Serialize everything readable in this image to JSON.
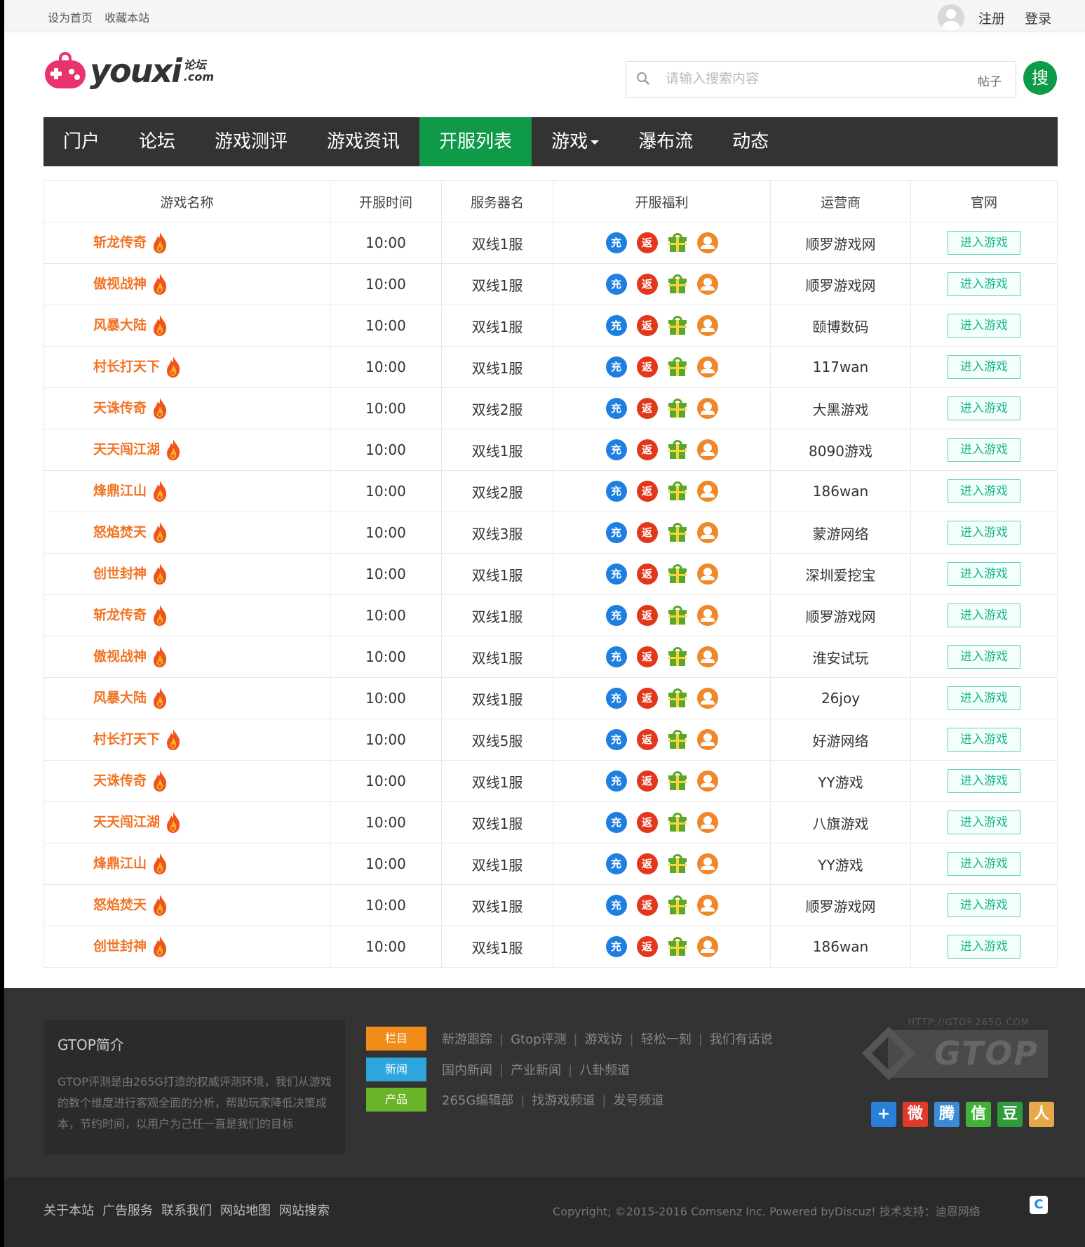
{
  "topbar": {
    "set_home": "设为首页",
    "bookmark": "收藏本站",
    "register": "注册",
    "login": "登录"
  },
  "logo": {
    "word": "youxi",
    "sub1": "论坛",
    "sub2": ".com"
  },
  "search": {
    "placeholder": "请输入搜索内容",
    "type": "帖子",
    "button": "搜"
  },
  "nav": [
    "门户",
    "论坛",
    "游戏测评",
    "游戏资讯",
    "开服列表",
    "游戏",
    "瀑布流",
    "动态"
  ],
  "table": {
    "headers": [
      "游戏名称",
      "开服时间",
      "服务器名",
      "开服福利",
      "运营商",
      "官网"
    ],
    "perk_icons": {
      "recharge": "充",
      "rebate": "返",
      "gift": "gift-icon",
      "service": "service-icon"
    },
    "enter_label": "进入游戏",
    "rows": [
      {
        "name": "斩龙传奇",
        "time": "10:00",
        "server": "双线1服",
        "op": "顺罗游戏网"
      },
      {
        "name": "傲视战神",
        "time": "10:00",
        "server": "双线1服",
        "op": "顺罗游戏网"
      },
      {
        "name": "风暴大陆",
        "time": "10:00",
        "server": "双线1服",
        "op": "颐博数码"
      },
      {
        "name": "村长打天下",
        "time": "10:00",
        "server": "双线1服",
        "op": "117wan"
      },
      {
        "name": "天诛传奇",
        "time": "10:00",
        "server": "双线2服",
        "op": "大黑游戏"
      },
      {
        "name": "天天闯江湖",
        "time": "10:00",
        "server": "双线1服",
        "op": "8090游戏"
      },
      {
        "name": "烽鼎江山",
        "time": "10:00",
        "server": "双线2服",
        "op": "186wan"
      },
      {
        "name": "怒焰焚天",
        "time": "10:00",
        "server": "双线3服",
        "op": "蒙游网络"
      },
      {
        "name": "创世封神",
        "time": "10:00",
        "server": "双线1服",
        "op": "深圳爱挖宝"
      },
      {
        "name": "斩龙传奇",
        "time": "10:00",
        "server": "双线1服",
        "op": "顺罗游戏网"
      },
      {
        "name": "傲视战神",
        "time": "10:00",
        "server": "双线1服",
        "op": "淮安试玩"
      },
      {
        "name": "风暴大陆",
        "time": "10:00",
        "server": "双线1服",
        "op": "26joy"
      },
      {
        "name": "村长打天下",
        "time": "10:00",
        "server": "双线5服",
        "op": "好游网络"
      },
      {
        "name": "天诛传奇",
        "time": "10:00",
        "server": "双线1服",
        "op": "YY游戏"
      },
      {
        "name": "天天闯江湖",
        "time": "10:00",
        "server": "双线1服",
        "op": "八旗游戏"
      },
      {
        "name": "烽鼎江山",
        "time": "10:00",
        "server": "双线1服",
        "op": "YY游戏"
      },
      {
        "name": "怒焰焚天",
        "time": "10:00",
        "server": "双线1服",
        "op": "顺罗游戏网"
      },
      {
        "name": "创世封神",
        "time": "10:00",
        "server": "双线1服",
        "op": "186wan"
      }
    ]
  },
  "footer": {
    "intro_title": "GTOP简介",
    "intro_text": "GTOP评测是由265G打造的权威评测环境，我们从游戏的数个维度进行客观全面的分析，帮助玩家降低决策成本，节约时间，以用户为己任一直是我们的目标",
    "categories": [
      {
        "tag": "栏目",
        "color": "#f28c18",
        "links": [
          "新游跟踪",
          "Gtop评测",
          "游戏访",
          "轻松一刻",
          "我们有话说"
        ]
      },
      {
        "tag": "新闻",
        "color": "#2ca6dd",
        "links": [
          "国内新闻",
          "产业新闻",
          "八卦频道"
        ]
      },
      {
        "tag": "产品",
        "color": "#6ab42a",
        "links": [
          "265G编辑部",
          "找游戏频道",
          "发号频道"
        ]
      }
    ],
    "gtop_url": "HTTP://GTOP.265G.COM",
    "gtop_text": "GTOP",
    "shares": [
      {
        "icon": "plus-share-icon",
        "glyph": "+",
        "color": "#2a7fd8"
      },
      {
        "icon": "weibo-share-icon",
        "glyph": "微",
        "color": "#e23a2a"
      },
      {
        "icon": "tencent-weibo-share-icon",
        "glyph": "腾",
        "color": "#3c8bd6"
      },
      {
        "icon": "wechat-share-icon",
        "glyph": "信",
        "color": "#43b03a"
      },
      {
        "icon": "douban-share-icon",
        "glyph": "豆",
        "color": "#2e9b3c"
      },
      {
        "icon": "renren-share-icon",
        "glyph": "人",
        "color": "#e6a94a"
      }
    ],
    "bottom_links": [
      "关于本站",
      "广告服务",
      "联系我们",
      "网站地图",
      "网站搜索"
    ],
    "copyright": "Copyright; ©2015-2016  Comsenz Inc.  Powered byDiscuz!  技术支持：迪恩网络"
  }
}
